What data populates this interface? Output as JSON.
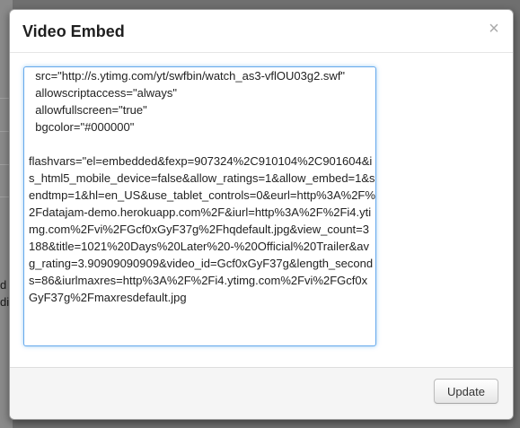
{
  "modal": {
    "title": "Video Embed",
    "close_glyph": "×",
    "embed_code": "  src=\"http://s.ytimg.com/yt/swfbin/watch_as3-vflOU03g2.swf\"\n  allowscriptaccess=\"always\"\n  allowfullscreen=\"true\"\n  bgcolor=\"#000000\"\n\nflashvars=\"el=embedded&fexp=907324%2C910104%2C901604&is_html5_mobile_device=false&allow_ratings=1&allow_embed=1&sendtmp=1&hl=en_US&use_tablet_controls=0&eurl=http%3A%2F%2Fdatajam-demo.herokuapp.com%2F&iurl=http%3A%2F%2Fi4.ytimg.com%2Fvi%2FGcf0xGyF37g%2Fhqdefault.jpg&view_count=3188&title=1021%20Days%20Later%20-%20Official%20Trailer&avg_rating=3.90909090909&video_id=Gcf0xGyF37g&length_seconds=86&iurlmaxres=http%3A%2F%2Fi4.ytimg.com%2Fvi%2FGcf0xGyF37g%2Fmaxresdefault.jpg",
    "update_label": "Update"
  },
  "background": {
    "fragment_1": "d",
    "fragment_2": "di"
  }
}
